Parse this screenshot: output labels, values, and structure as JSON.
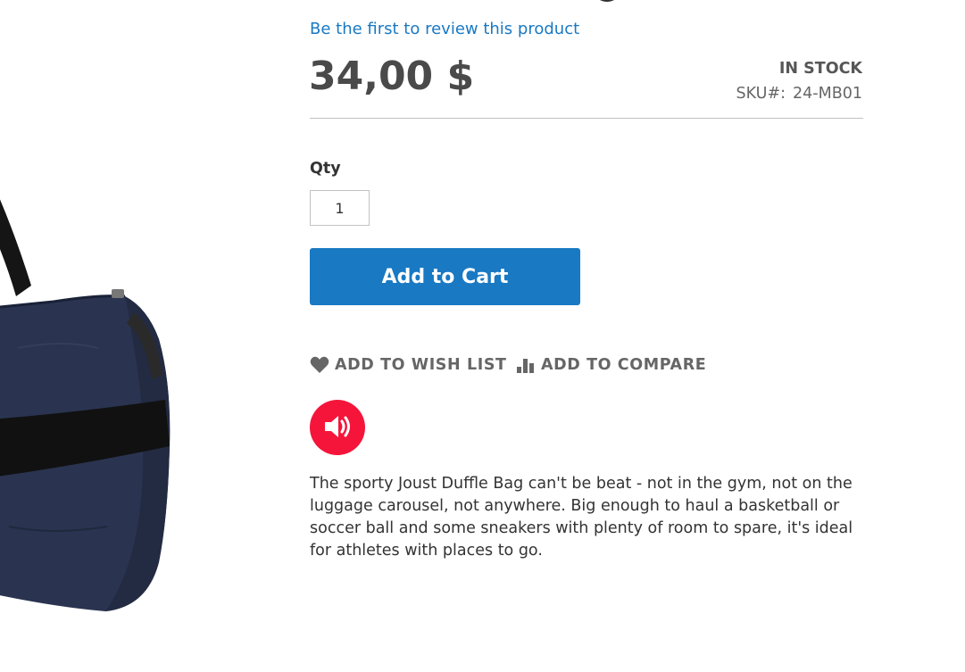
{
  "product": {
    "review_link": "Be the first to review this product",
    "price": "34,00 $",
    "stock_status": "IN STOCK",
    "sku_label": "SKU#:",
    "sku_value": "24-MB01",
    "qty_label": "Qty",
    "qty_value": "1",
    "add_to_cart_label": "Add to Cart",
    "wishlist_label": "ADD TO WISH LIST",
    "compare_label": "ADD TO COMPARE",
    "description": "The sporty Joust Duffle Bag can't be beat - not in the gym, not on the luggage carousel, not anywhere. Big enough to haul a basketball or soccer ball and some sneakers with plenty of room to spare, it's ideal for athletes with places to go."
  },
  "icons": {
    "wishlist": "heart-icon",
    "compare": "bar-chart-icon",
    "audio": "speaker-icon"
  },
  "colors": {
    "link": "#1979c3",
    "primary_button": "#1979c3",
    "audio_button": "#f5153a",
    "bag": "#2a3450"
  }
}
